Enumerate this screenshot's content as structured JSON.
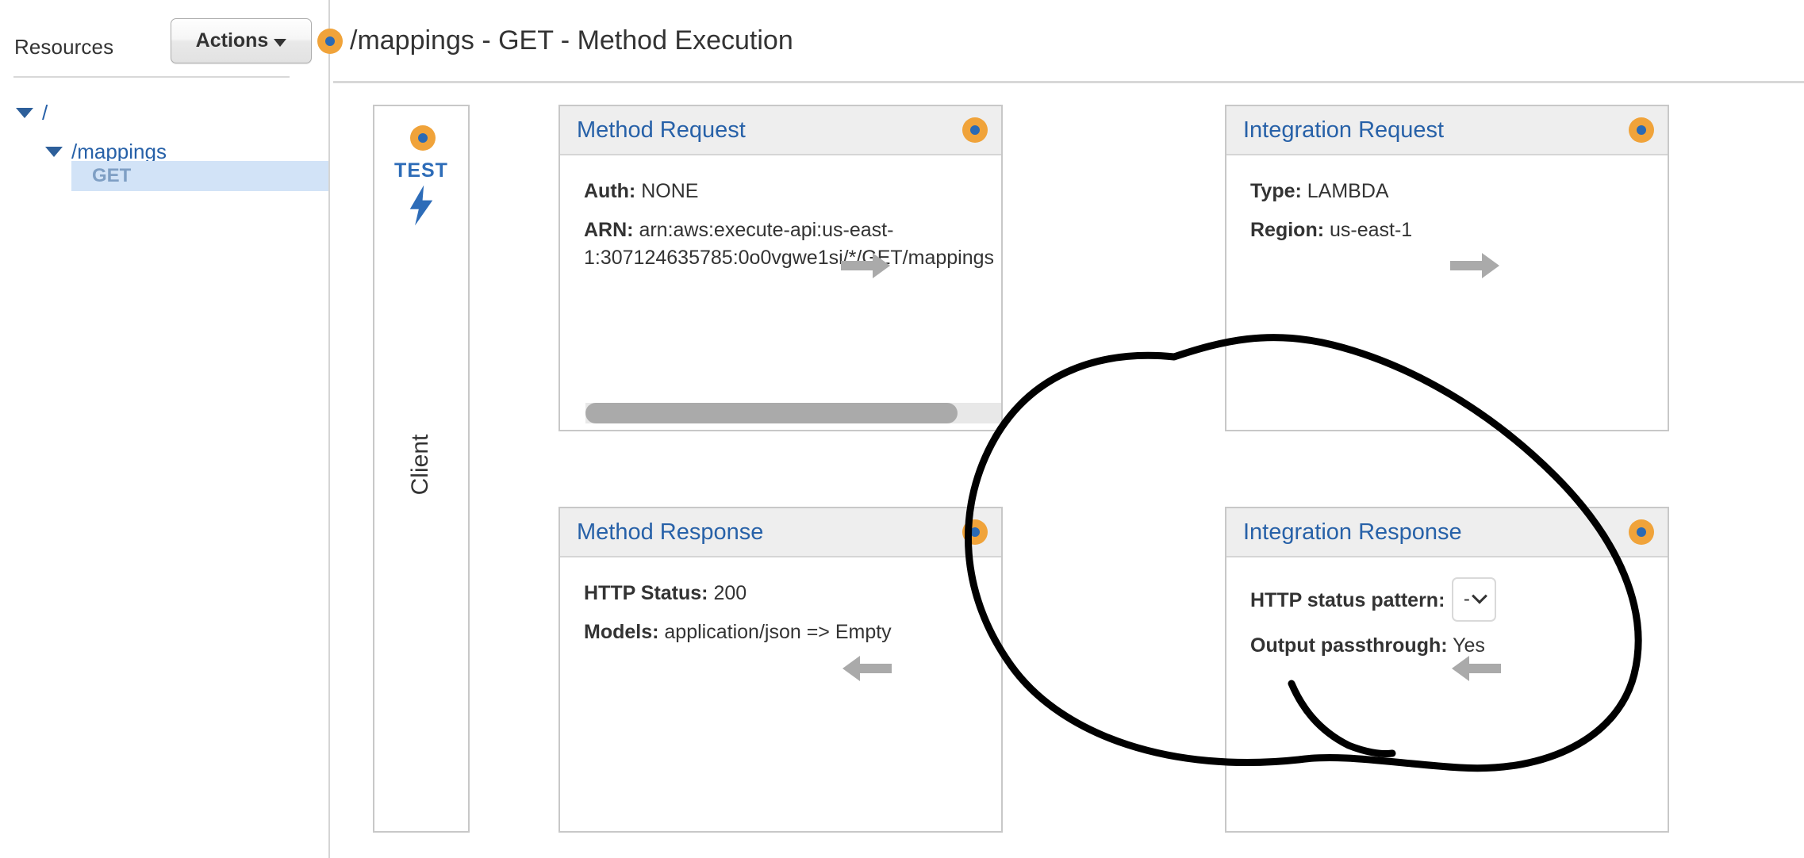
{
  "sidebar": {
    "title": "Resources",
    "actions_button": "Actions",
    "tree": [
      {
        "label": "/",
        "icon": "caret-down-icon",
        "depth": 0,
        "selected": false
      },
      {
        "label": "/mappings",
        "icon": "caret-down-icon",
        "depth": 1,
        "selected": false
      },
      {
        "label": "GET",
        "icon": "",
        "depth": 2,
        "selected": true
      }
    ]
  },
  "header": {
    "title": "/mappings - GET - Method Execution",
    "node_icon": "method-node-icon"
  },
  "client": {
    "test_label": "TEST",
    "test_icon": "lightning-bolt-icon",
    "node_icon": "method-node-icon",
    "label": "Client"
  },
  "boxes": {
    "method_request": {
      "title": "Method Request",
      "node_icon": "method-node-icon",
      "rows": [
        {
          "key": "Auth:",
          "value": "NONE"
        },
        {
          "key": "ARN:",
          "value": "arn:aws:execute-api:us-east-1:307124635785:0o0vgwe1si/*/GET/mappings"
        }
      ],
      "scrollbar": "horizontal-scrollbar"
    },
    "integration_request": {
      "title": "Integration Request",
      "node_icon": "method-node-icon",
      "rows": [
        {
          "key": "Type:",
          "value": "LAMBDA"
        },
        {
          "key": "Region:",
          "value": "us-east-1"
        }
      ]
    },
    "method_response": {
      "title": "Method Response",
      "node_icon": "method-node-icon",
      "rows": [
        {
          "key": "HTTP Status:",
          "value": "200"
        },
        {
          "key": "Models:",
          "value": "application/json => Empty"
        }
      ]
    },
    "integration_response": {
      "title": "Integration Response",
      "node_icon": "method-node-icon",
      "status_pattern_label": "HTTP status pattern:",
      "status_pattern_value": "-",
      "status_pattern_options": [
        "-"
      ],
      "rows": [
        {
          "key": "Output passthrough:",
          "value": "Yes"
        }
      ]
    }
  },
  "arrows": [
    {
      "name": "arrow-client-to-method-request",
      "direction": "right"
    },
    {
      "name": "arrow-method-request-to-integration-request",
      "direction": "right"
    },
    {
      "name": "arrow-integration-request-to-backend",
      "direction": "right"
    },
    {
      "name": "arrow-method-response-to-client",
      "direction": "left"
    },
    {
      "name": "arrow-integration-response-to-method-response",
      "direction": "left"
    },
    {
      "name": "arrow-backend-to-integration-response",
      "direction": "left"
    }
  ],
  "annotation": {
    "type": "hand-drawn-circle",
    "color": "#000000",
    "target": "integration-response-box"
  },
  "colors": {
    "accent_blue": "#2761a8",
    "node_orange": "#f0a33a",
    "node_inner_blue": "#2a6ab5",
    "selection_blue": "#d2e3f7",
    "arrow_grey": "#aaaaaa",
    "panel_header_grey": "#eeeeee",
    "border_grey": "#c8c8c8"
  }
}
